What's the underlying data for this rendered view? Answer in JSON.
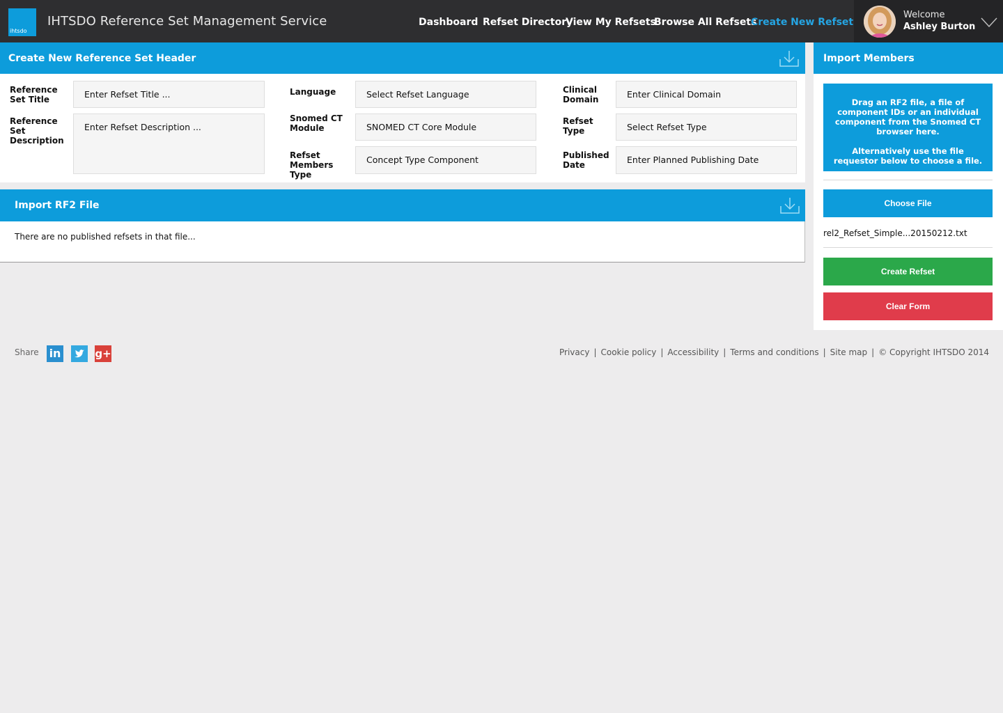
{
  "header": {
    "logo_text": "ihtsdo",
    "app_title": "IHTSDO Reference Set Management Service",
    "nav": [
      {
        "label": "Dashboard"
      },
      {
        "label": "Refset Directory"
      },
      {
        "label": "View My Refsets"
      },
      {
        "label": "Browse All Refsets"
      },
      {
        "label": "Create New Refset",
        "active": true
      }
    ],
    "welcome": "Welcome",
    "user_name": "Ashley Burton"
  },
  "create_panel": {
    "title": "Create New Reference Set Header",
    "labels": {
      "title": "Reference Set Title",
      "description": "Reference Set Description",
      "language": "Language",
      "module": "Snomed CT Module",
      "members_type": "Refset Members Type",
      "clinical_domain": "Clinical Domain",
      "refset_type": "Refset Type",
      "published_date": "Published Date"
    },
    "fields": {
      "title": "Enter Refset  Title ...",
      "description": "Enter Refset  Description ...",
      "language": "Select Refset Language",
      "module": "SNOMED CT Core Module",
      "members_type": "Concept Type Component",
      "clinical_domain": "Enter Clinical Domain",
      "refset_type": "Select Refset Type",
      "published_date": "Enter Planned Publishing Date"
    }
  },
  "import_rf2": {
    "title": "Import RF2 File",
    "message": "There are no published refsets in that file..."
  },
  "import_members": {
    "title": "Import Members",
    "drop_text_1": "Drag an RF2 file, a file of component IDs or an individual component from the Snomed CT browser here.",
    "drop_text_2": "Alternatively use the file requestor below to choose a file.",
    "choose_file": "Choose File",
    "file_name": "rel2_Refset_Simple...20150212.txt",
    "create_refset": "Create Refset",
    "clear_form": "Clear Form"
  },
  "footer": {
    "share": "Share",
    "social": [
      "linkedin-icon",
      "twitter-icon",
      "google-plus-icon"
    ],
    "links": [
      "Privacy",
      "Cookie policy",
      "Accessibility",
      "Terms and conditions",
      "Site map"
    ],
    "copyright": "© Copyright IHTSDO 2014"
  },
  "colors": {
    "accent": "#0d9cdb",
    "nav_bg": "#2e2e30",
    "create": "#2ba84a",
    "clear": "#e03c4b"
  }
}
